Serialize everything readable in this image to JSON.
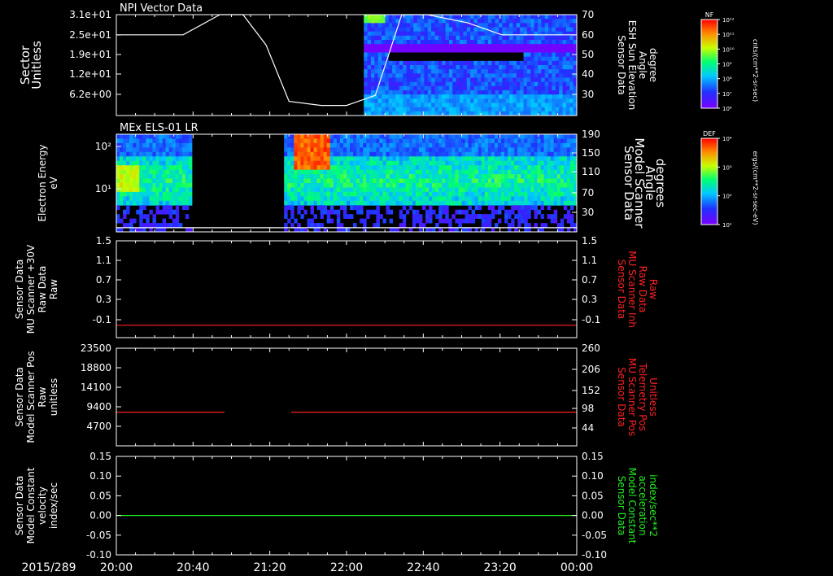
{
  "date_label": "2015/289",
  "time_ticks": [
    "20:00",
    "20:40",
    "21:20",
    "22:00",
    "22:40",
    "23:20",
    "00:00"
  ],
  "colors": {
    "background": "#000000",
    "axis": "#ffffff",
    "red_trace": "#ff2020",
    "green_trace": "#22ee22",
    "right_label_red": "#ff2020",
    "right_label_green": "#22ee22"
  },
  "colorbars": [
    {
      "label": "NF",
      "units": "cnts/(cm**2-sr-sec)",
      "ticks": [
        "10¹²",
        "10¹¹",
        "10¹⁰",
        "10⁹",
        "10⁸",
        "10⁷",
        "10⁶"
      ],
      "scale": "log"
    },
    {
      "label": "DEF",
      "units": "ergs/(cm**2-sr-sec-eV)",
      "ticks": [
        "10⁴",
        "10³",
        "10²",
        "10¹"
      ],
      "scale": "log"
    }
  ],
  "chart_data": [
    {
      "type": "heatmap",
      "title": "NPI Vector Data",
      "ylabel": [
        "Sector",
        "Unitless"
      ],
      "left_ticks": [
        "3.1e+01",
        "2.5e+01",
        "1.9e+01",
        "1.2e+01",
        "6.2e+00"
      ],
      "right_ticks": [
        "70",
        "60",
        "50",
        "40",
        "30"
      ],
      "right_ylim": [
        20,
        70
      ],
      "right_label": [
        "Sensor Data",
        "ESH Sun Elevation",
        "Angle",
        "degree"
      ],
      "right_label_color": "white",
      "overlay_line": {
        "name": "ESH Sun Elevation Angle",
        "x": [
          20.0,
          20.58,
          20.9,
          21.1,
          21.3,
          21.5,
          21.78,
          22.0,
          22.25,
          22.48,
          22.7,
          23.05,
          23.35,
          24.0
        ],
        "y": [
          60,
          60,
          70,
          70,
          55,
          27,
          25,
          25,
          30,
          70,
          70,
          66,
          60,
          60
        ]
      },
      "heatmap_region": {
        "x_start": 22.15,
        "x_end": 24.0,
        "colormap": "rainbow"
      }
    },
    {
      "type": "heatmap",
      "title": "MEx ELS-01 LR",
      "ylabel": [
        "Electron Energy",
        "eV"
      ],
      "left_ticks": [
        "10²",
        "10¹"
      ],
      "right_ticks": [
        "190",
        "150",
        "110",
        "70",
        "30"
      ],
      "right_ylim": [
        0,
        190
      ],
      "right_label": [
        "Sensor Data",
        "Model Scanner",
        "Angle",
        "degrees"
      ],
      "right_label_color": "white",
      "data_gaps": [
        [
          20.66,
          21.46
        ]
      ],
      "overlay_line": {
        "name": "Model Scanner Angle",
        "x": [
          20.0,
          20.66,
          21.46,
          24.0
        ],
        "y": [
          8,
          8,
          8,
          8
        ]
      }
    },
    {
      "type": "line",
      "ylabel": [
        "Sensor Data",
        "MU Scanner +30V",
        "Raw Data",
        "Raw"
      ],
      "left_ticks": [
        "1.5",
        "1.1",
        "0.7",
        "0.3",
        "-0.1"
      ],
      "right_ticks": [
        "1.5",
        "1.1",
        "0.7",
        "0.3",
        "-0.1"
      ],
      "ylim": [
        -0.3,
        1.5
      ],
      "right_label": [
        "Sensor Data",
        "MU Scanner Inh",
        "Raw Data",
        "Raw"
      ],
      "right_label_color": "red",
      "series": [
        {
          "x": [
            20.0,
            24.0
          ],
          "y": [
            -0.07,
            -0.07
          ],
          "color": "red"
        }
      ]
    },
    {
      "type": "line",
      "ylabel": [
        "Sensor Data",
        "Model Scanner Pos",
        "Raw",
        "unitless"
      ],
      "left_ticks": [
        "23500",
        "18800",
        "14100",
        "9400",
        "4700"
      ],
      "right_ticks": [
        "260",
        "206",
        "152",
        "98",
        "44"
      ],
      "ylim": [
        0,
        23500
      ],
      "right_label": [
        "Sensor Data",
        "MU Scanner Pos",
        "Telemetry Pos",
        "Unitless"
      ],
      "right_label_color": "red",
      "series": [
        {
          "x": [
            20.0,
            20.94
          ],
          "y": [
            8100,
            8100
          ],
          "color": "red"
        },
        {
          "x": [
            21.52,
            24.0
          ],
          "y": [
            8100,
            8100
          ],
          "color": "red"
        }
      ]
    },
    {
      "type": "line",
      "ylabel": [
        "Sensor Data",
        "Model Constant",
        "velocity",
        "index/sec"
      ],
      "left_ticks": [
        "0.15",
        "0.10",
        "0.05",
        "0.00",
        "-0.05",
        "-0.10"
      ],
      "right_ticks": [
        "0.15",
        "0.10",
        "0.05",
        "0.00",
        "-0.05",
        "-0.10"
      ],
      "ylim": [
        -0.1,
        0.15
      ],
      "right_label": [
        "Sensor Data",
        "Model Constant",
        "acceleration",
        "index/sec**2"
      ],
      "right_label_color": "green",
      "series": [
        {
          "x": [
            20.0,
            24.0
          ],
          "y": [
            0.0,
            0.0
          ],
          "color": "green"
        }
      ]
    }
  ]
}
